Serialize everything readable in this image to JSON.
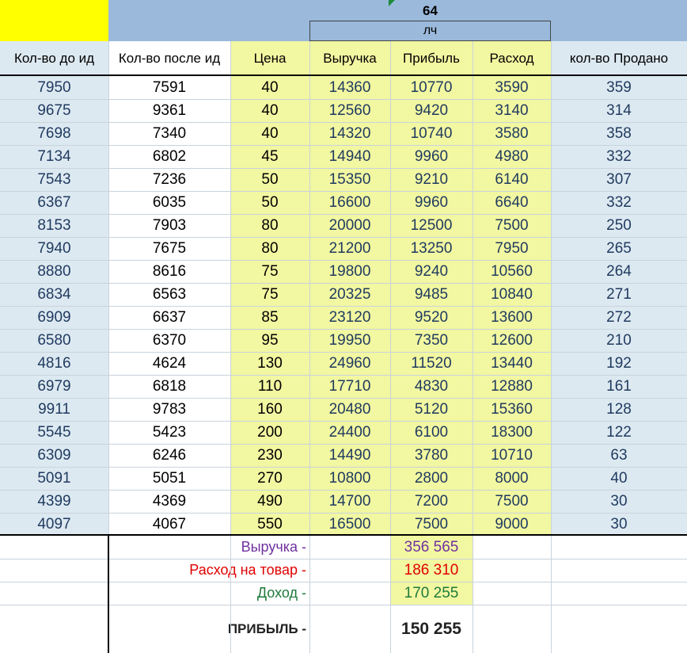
{
  "header": {
    "top_value": "64",
    "sub_label": "лч",
    "columns": [
      "Кол-во до ид",
      "Кол-во после ид",
      "Цена",
      "Выручка",
      "Прибыль",
      "Расход",
      "кол-во Продано"
    ]
  },
  "rows": [
    [
      "7950",
      "7591",
      "40",
      "14360",
      "10770",
      "3590",
      "359"
    ],
    [
      "9675",
      "9361",
      "40",
      "12560",
      "9420",
      "3140",
      "314"
    ],
    [
      "7698",
      "7340",
      "40",
      "14320",
      "10740",
      "3580",
      "358"
    ],
    [
      "7134",
      "6802",
      "45",
      "14940",
      "9960",
      "4980",
      "332"
    ],
    [
      "7543",
      "7236",
      "50",
      "15350",
      "9210",
      "6140",
      "307"
    ],
    [
      "6367",
      "6035",
      "50",
      "16600",
      "9960",
      "6640",
      "332"
    ],
    [
      "8153",
      "7903",
      "80",
      "20000",
      "12500",
      "7500",
      "250"
    ],
    [
      "7940",
      "7675",
      "80",
      "21200",
      "13250",
      "7950",
      "265"
    ],
    [
      "8880",
      "8616",
      "75",
      "19800",
      "9240",
      "10560",
      "264"
    ],
    [
      "6834",
      "6563",
      "75",
      "20325",
      "9485",
      "10840",
      "271"
    ],
    [
      "6909",
      "6637",
      "85",
      "23120",
      "9520",
      "13600",
      "272"
    ],
    [
      "6580",
      "6370",
      "95",
      "19950",
      "7350",
      "12600",
      "210"
    ],
    [
      "4816",
      "4624",
      "130",
      "24960",
      "11520",
      "13440",
      "192"
    ],
    [
      "6979",
      "6818",
      "110",
      "17710",
      "4830",
      "12880",
      "161"
    ],
    [
      "9911",
      "9783",
      "160",
      "20480",
      "5120",
      "15360",
      "128"
    ],
    [
      "5545",
      "5423",
      "200",
      "24400",
      "6100",
      "18300",
      "122"
    ],
    [
      "6309",
      "6246",
      "230",
      "14490",
      "3780",
      "10710",
      "63"
    ],
    [
      "5091",
      "5051",
      "270",
      "10800",
      "2800",
      "8000",
      "40"
    ],
    [
      "4399",
      "4369",
      "490",
      "14700",
      "7200",
      "7500",
      "30"
    ],
    [
      "4097",
      "4067",
      "550",
      "16500",
      "7500",
      "9000",
      "30"
    ]
  ],
  "summary": [
    {
      "label": "Выручка -",
      "value": "356 565",
      "color": "#7030a0"
    },
    {
      "label": "Расход на товар -",
      "value": "186 310",
      "color": "#e00000"
    },
    {
      "label": "Доход -",
      "value": "170 255",
      "color": "#1e7a3c"
    },
    {
      "label": "ПРИБЫЛЬ -",
      "value": "150 255",
      "color": "#222222"
    }
  ],
  "colors": {
    "header_blue": "#9ab9db",
    "cell_blue": "#dde9f1",
    "cell_yellow": "#f2f7a1",
    "corner_yellow": "#ffff00",
    "value_navy": "#1f3a5f"
  }
}
